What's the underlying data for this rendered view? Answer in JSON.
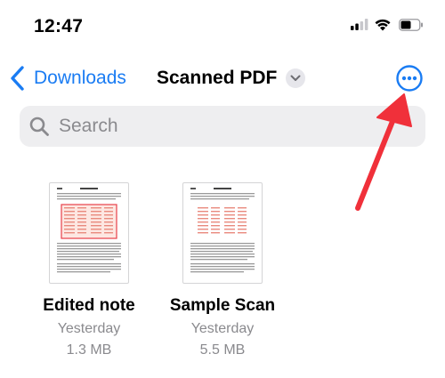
{
  "status_bar": {
    "time": "12:47"
  },
  "nav": {
    "back_label": "Downloads",
    "title": "Scanned PDF",
    "more_icon": "ellipsis-circle-icon",
    "accent_color": "#1a7cf3"
  },
  "search": {
    "placeholder": "Search"
  },
  "files": [
    {
      "name": "Edited note",
      "date": "Yesterday",
      "size": "1.3 MB",
      "highlight": "red-box"
    },
    {
      "name": "Sample Scan",
      "date": "Yesterday",
      "size": "5.5 MB",
      "highlight": "none"
    }
  ],
  "annotation": {
    "color": "#f0303a",
    "points_to": "more-button"
  }
}
